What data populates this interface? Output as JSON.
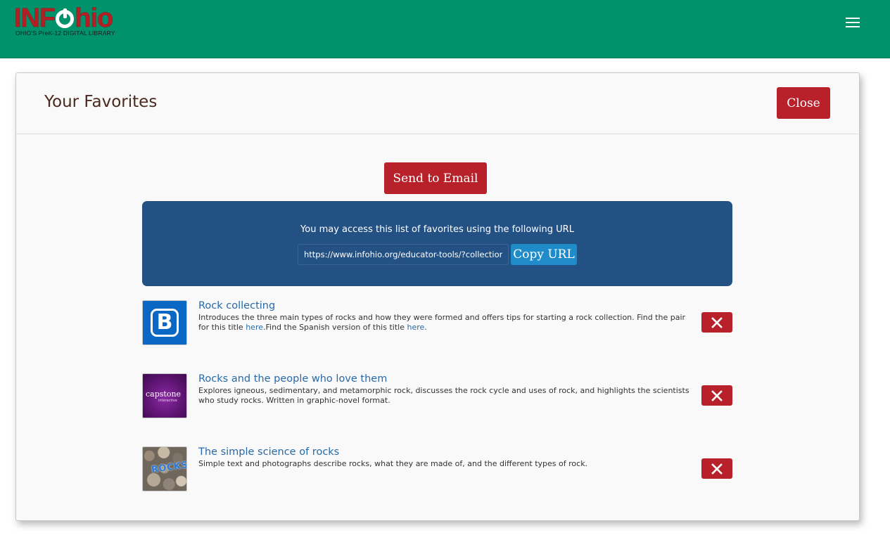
{
  "header": {
    "logo_left": "INF",
    "logo_right": "hio",
    "logo_tagline": "OHIO'S PreK-12 DIGITAL LIBRARY",
    "menu_icon": "hamburger-menu-icon",
    "background_color": "#00936b",
    "logo_color": "#b31f25"
  },
  "modal": {
    "title": "Your Favorites",
    "close_label": "Close",
    "send_email_label": "Send to Email",
    "url_panel": {
      "text": "You may access this list of favorites using the following URL",
      "url_value": "https://www.infohio.org/educator-tools/?collection",
      "copy_label": "Copy URL",
      "background_color": "#245184"
    },
    "button_color": "#b8202a"
  },
  "favorites": [
    {
      "title": "Rock collecting",
      "description_text": "Introduces the three main types of rocks and how they were formed and offers tips for starting a rock collection. Find the pair for this title ",
      "link1": "here",
      "middle_text": ".Find the Spanish version of this title ",
      "link2": "here",
      "end_text": ".",
      "thumbnail": {
        "type": "publisher-logo",
        "icon": "b-logo-icon",
        "letter": "B",
        "color": "#0a67c4"
      },
      "remove_icon": "close-x-icon"
    },
    {
      "title": "Rocks and the people who love them",
      "description_text": "Explores igneous, sedimentary, and metamorphic rock, discusses the rock cycle and uses of rock, and highlights the scientists who study rocks. Written in graphic-novel format.",
      "thumbnail": {
        "type": "publisher-logo",
        "text": "capstone",
        "subtext": "interactive",
        "color": "#5c1470"
      },
      "remove_icon": "close-x-icon"
    },
    {
      "title": "The simple science of rocks",
      "description_text": "Simple text and photographs describe rocks, what they are made of, and the different types of rock.",
      "thumbnail": {
        "type": "book-cover",
        "text": "ROCKS"
      },
      "remove_icon": "close-x-icon"
    }
  ]
}
